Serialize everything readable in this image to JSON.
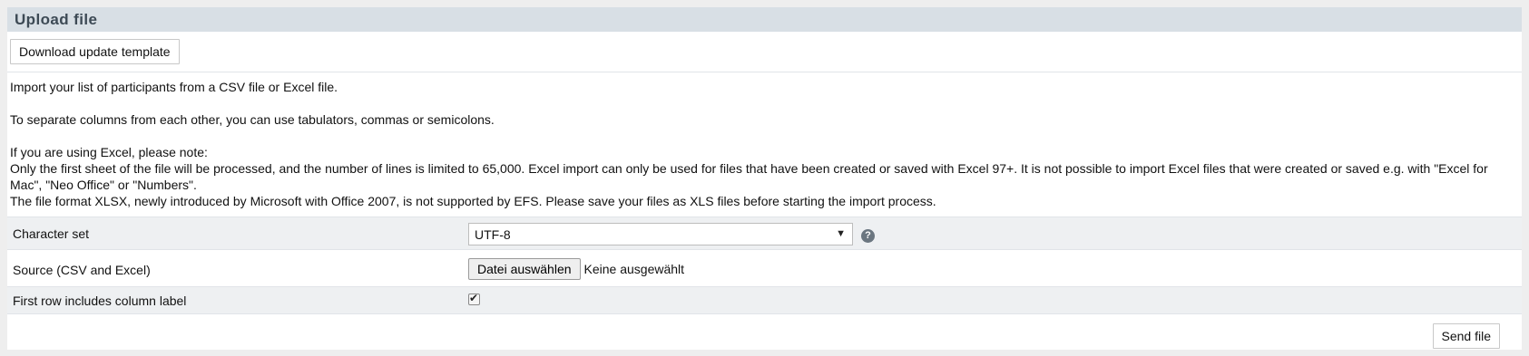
{
  "panel": {
    "title": "Upload file"
  },
  "toolbar": {
    "download_template_label": "Download update template"
  },
  "description": {
    "line1": "Import your list of participants from a CSV file or Excel file.",
    "line2": "To separate columns from each other, you can use tabulators, commas or semicolons.",
    "line3": "If you are using Excel, please note:",
    "line4": "Only the first sheet of the file will be processed, and the number of lines is limited to 65,000. Excel import can only be used for files that have been created or saved with Excel 97+. It is not possible to import Excel files that were created or saved e.g. with \"Excel for Mac\", \"Neo Office\" or \"Numbers\".",
    "line5": "The file format XLSX, newly introduced by Microsoft with Office 2007, is not supported by EFS. Please save your files as XLS files before starting the import process."
  },
  "form": {
    "charset": {
      "label": "Character set",
      "value": "UTF-8",
      "caret_icon": "chevron-down-icon",
      "help_icon": "help-icon",
      "help_glyph": "?"
    },
    "source": {
      "label": "Source (CSV and Excel)",
      "button_label": "Datei auswählen",
      "status": "Keine ausgewählt"
    },
    "first_row": {
      "label": "First row includes column label",
      "checked": true
    }
  },
  "footer": {
    "send_label": "Send file"
  },
  "colors": {
    "header_bg": "#d8dfe5",
    "header_text": "#3d4a55",
    "row_shade": "#eef0f2",
    "page_bg": "#eeeeee"
  }
}
